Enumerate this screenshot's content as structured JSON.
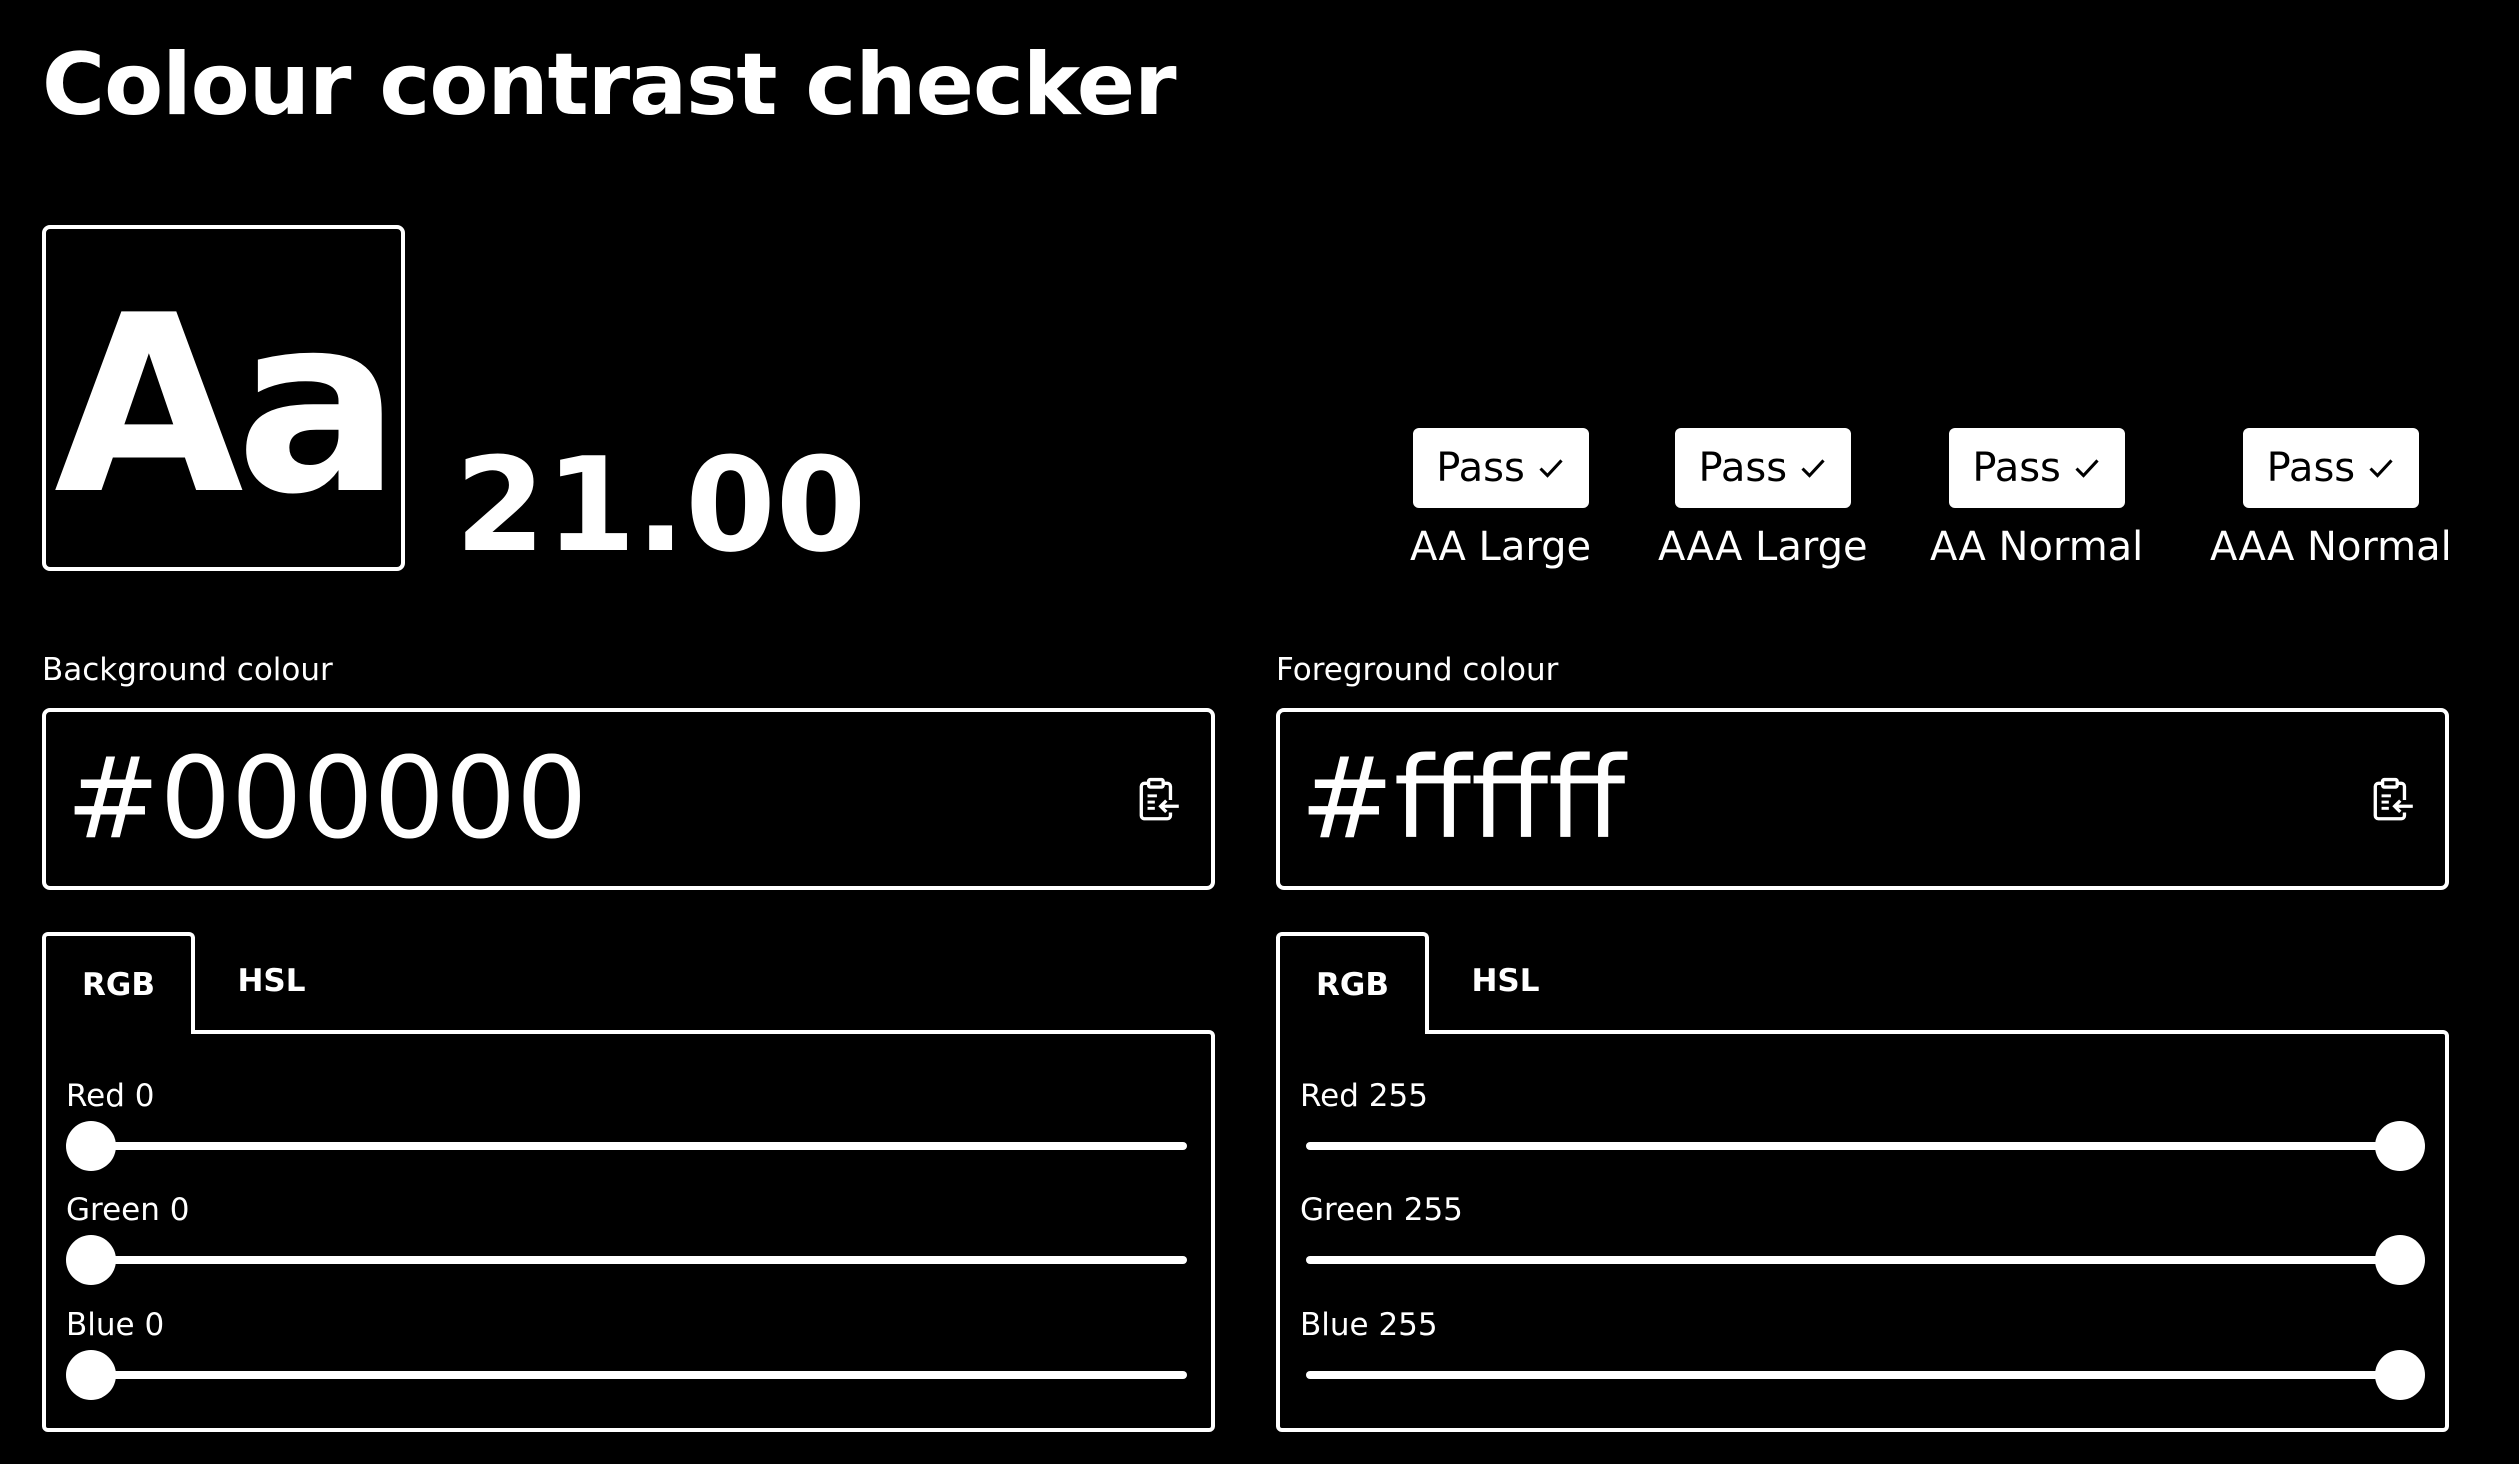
{
  "title": "Colour contrast checker",
  "preview": {
    "text": "Aa",
    "background": "#000000",
    "foreground": "#ffffff"
  },
  "contrast_ratio": "21.00",
  "results": [
    {
      "status": "Pass",
      "label": "AA Large",
      "icon": "check-icon"
    },
    {
      "status": "Pass",
      "label": "AAA Large",
      "icon": "check-icon"
    },
    {
      "status": "Pass",
      "label": "AA Normal",
      "icon": "check-icon"
    },
    {
      "status": "Pass",
      "label": "AAA Normal",
      "icon": "check-icon"
    }
  ],
  "background": {
    "label": "Background colour",
    "value": "#000000",
    "paste_icon": "clipboard-paste-icon",
    "tabs": [
      "RGB",
      "HSL"
    ],
    "active_tab": "RGB",
    "sliders": [
      {
        "label": "Red 0",
        "value": 0,
        "max": 255
      },
      {
        "label": "Green 0",
        "value": 0,
        "max": 255
      },
      {
        "label": "Blue 0",
        "value": 0,
        "max": 255
      }
    ]
  },
  "foreground": {
    "label": "Foreground colour",
    "value": "#ffffff",
    "paste_icon": "clipboard-paste-icon",
    "tabs": [
      "RGB",
      "HSL"
    ],
    "active_tab": "RGB",
    "sliders": [
      {
        "label": "Red 255",
        "value": 255,
        "max": 255
      },
      {
        "label": "Green 255",
        "value": 255,
        "max": 255
      },
      {
        "label": "Blue 255",
        "value": 255,
        "max": 255
      }
    ]
  }
}
